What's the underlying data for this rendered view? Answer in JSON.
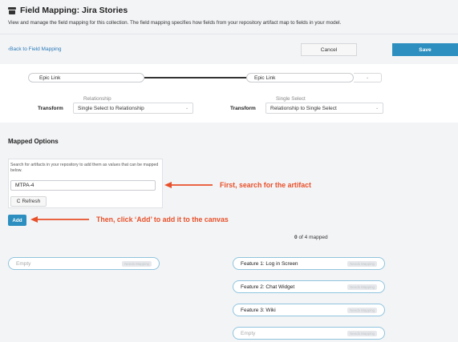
{
  "header": {
    "title": "Field Mapping: Jira Stories",
    "subtitle": "View and manage the field mapping for this collection. The field mapping specifies how fields from your repository artifact map to fields in your model."
  },
  "toolbar": {
    "back_label": "Back to Field Mapping",
    "cancel_label": "Cancel",
    "save_label": "Save"
  },
  "mapping": {
    "left_field": "Epic Link",
    "right_field": "Epic Link",
    "left_relationship_label": "Relationship",
    "right_relationship_label": "Single Select",
    "transform_label": "Transform",
    "left_transform_value": "Single Select to Relationship",
    "right_transform_value": "Relationship to Single Select"
  },
  "mapped_options": {
    "title": "Mapped Options",
    "search_description": "Search for artifacts in your repository to add them as values that can be mapped below.",
    "search_value": "MTPA-4",
    "refresh_label": "Refresh",
    "add_label": "Add",
    "mapped_count": "0",
    "mapped_suffix": "of 4 mapped"
  },
  "annotations": {
    "first": "First, search for the artifact",
    "second": "Then, click ‘Add’ to add it to the canvas"
  },
  "left_list": [
    {
      "label": "Empty",
      "badge": "Needs Mapping"
    }
  ],
  "right_list": [
    {
      "label": "Feature 1: Log in Screen",
      "badge": "Needs Mapping"
    },
    {
      "label": "Feature 2: Chat Widget",
      "badge": "Needs Mapping"
    },
    {
      "label": "Feature 3: Wiki",
      "badge": "Needs Mapping"
    },
    {
      "label": "Empty",
      "badge": "Needs Mapping"
    }
  ],
  "colors": {
    "accent": "#2c8fbf",
    "annotation": "#e8502a",
    "pill_border": "#8fc4dd"
  },
  "icons": {
    "title_icon": "archive-icon",
    "back_icon": "chevron-left-icon",
    "refresh_icon": "refresh-icon",
    "arrow_icon": "arrow-left-icon"
  }
}
